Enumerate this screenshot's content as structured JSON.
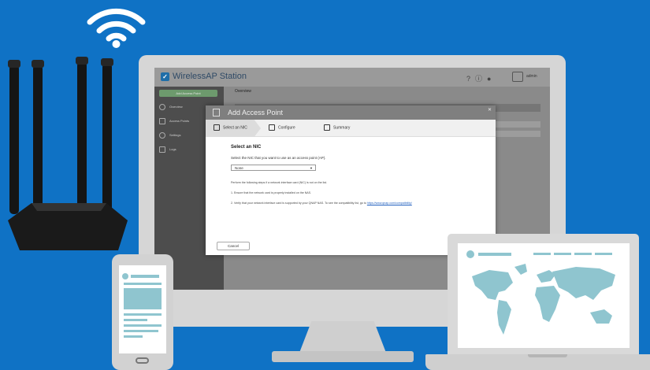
{
  "colors": {
    "background": "#0f72c5",
    "device_frame": "#d6d6d6",
    "accent_teal": "#8fc5cf",
    "link_blue": "#1f5fbf"
  },
  "app": {
    "title": "WirelessAP Station",
    "header_icons": [
      "help-icon",
      "info-icon",
      "globe-icon"
    ],
    "username": "admin",
    "sidebar": {
      "add_button": "Add Access Point",
      "items": [
        {
          "label": "Overview",
          "icon": "dashboard-icon"
        },
        {
          "label": "Access Points",
          "icon": "access-point-icon"
        },
        {
          "label": "Settings",
          "icon": "gear-icon"
        },
        {
          "label": "Logs",
          "icon": "chart-icon"
        }
      ]
    },
    "main": {
      "tab": "Overview"
    }
  },
  "modal": {
    "title": "Add Access Point",
    "steps": [
      {
        "label": "Select an NIC",
        "icon": "nic-icon"
      },
      {
        "label": "Configure",
        "icon": "configure-icon"
      },
      {
        "label": "Summary",
        "icon": "summary-icon"
      }
    ],
    "section_title": "Select an NIC",
    "description": "Select the NIC that you want to use as an access point (AP).",
    "select": {
      "value": "None"
    },
    "info_intro": "Perform the following steps if a network interface card (NIC) is not on the list.",
    "info_step1": "1. Ensure that the network card is properly installed on the NAS.",
    "info_step2": "2. Verify that your network interface card is supported by your QNAP NAS. To see the compatibility list, go to",
    "info_link": "https://www.qnap.com/compatibility/",
    "cancel_label": "Cancel"
  }
}
